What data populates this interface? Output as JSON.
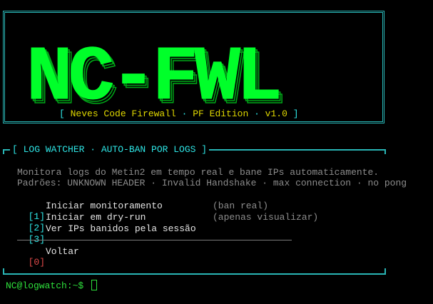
{
  "banner": {
    "logo_text": "NC-FWL",
    "subtitle_open": "[ ",
    "subtitle_brand": "Neves Code Firewall",
    "subtitle_sep1": " · ",
    "subtitle_edition": "PF Edition",
    "subtitle_sep2": " · ",
    "subtitle_version": "v1.0",
    "subtitle_close": " ]"
  },
  "panel": {
    "title": "[ LOG WATCHER · AUTO-BAN POR LOGS ]",
    "description_line1": "Monitora logs do Metin2 em tempo real e bane IPs automaticamente.",
    "description_line2": "Padrões: UNKNOWN HEADER · Invalid Handshake · max connection · no pong"
  },
  "menu": [
    {
      "key": "[1]",
      "label": "Iniciar monitoramento",
      "hint": "(ban real)"
    },
    {
      "key": "[2]",
      "label": "Iniciar em dry-run",
      "hint": "(apenas visualizar)"
    },
    {
      "key": "[3]",
      "label": "Ver IPs banidos pela sessão",
      "hint": ""
    }
  ],
  "exit_item": {
    "key": "[0]",
    "label": "Voltar"
  },
  "prompt": {
    "text": "NC@logwatch:~$ "
  },
  "colors": {
    "logo_fill": "#00ff2a",
    "logo_shadow": "#00a818",
    "border": "#29b5b5",
    "accent_cyan": "#2ee6e6",
    "subtitle_yellow": "#e0d800",
    "exit_red": "#e04a4a",
    "prompt_green": "#2ee03c"
  }
}
